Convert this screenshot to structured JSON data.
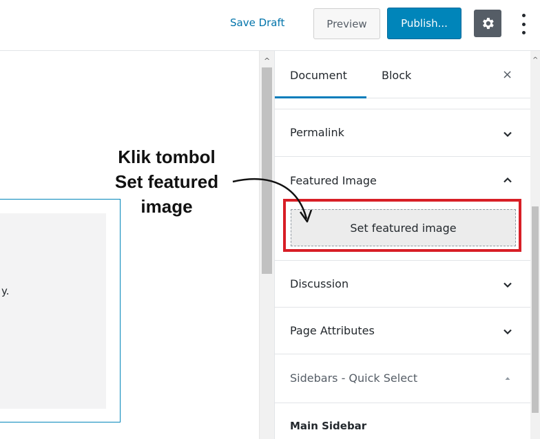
{
  "toolbar": {
    "save_draft": "Save Draft",
    "preview": "Preview",
    "publish": "Publish...",
    "settings_icon": "gear-icon",
    "more_icon": "vertical-ellipsis-icon",
    "colors": {
      "link": "#0073aa",
      "publish_bg": "#0085ba",
      "settings_bg": "#555d66"
    }
  },
  "editor": {
    "text_fragment": "y."
  },
  "sidebar": {
    "tabs": [
      {
        "label": "Document",
        "active": true
      },
      {
        "label": "Block",
        "active": false
      }
    ],
    "close_label": "×",
    "panels": [
      {
        "title": "Permalink",
        "state": "collapsed"
      },
      {
        "title": "Featured Image",
        "state": "expanded",
        "button": "Set featured image"
      },
      {
        "title": "Discussion",
        "state": "collapsed"
      },
      {
        "title": "Page Attributes",
        "state": "collapsed"
      },
      {
        "title": "Sidebars - Quick Select",
        "state": "expanded"
      },
      {
        "title": "Main Sidebar"
      }
    ]
  },
  "annotation": {
    "line1": "Klik tombol",
    "line2": "Set featured",
    "line3": "image",
    "highlight_color": "#d81e26"
  }
}
